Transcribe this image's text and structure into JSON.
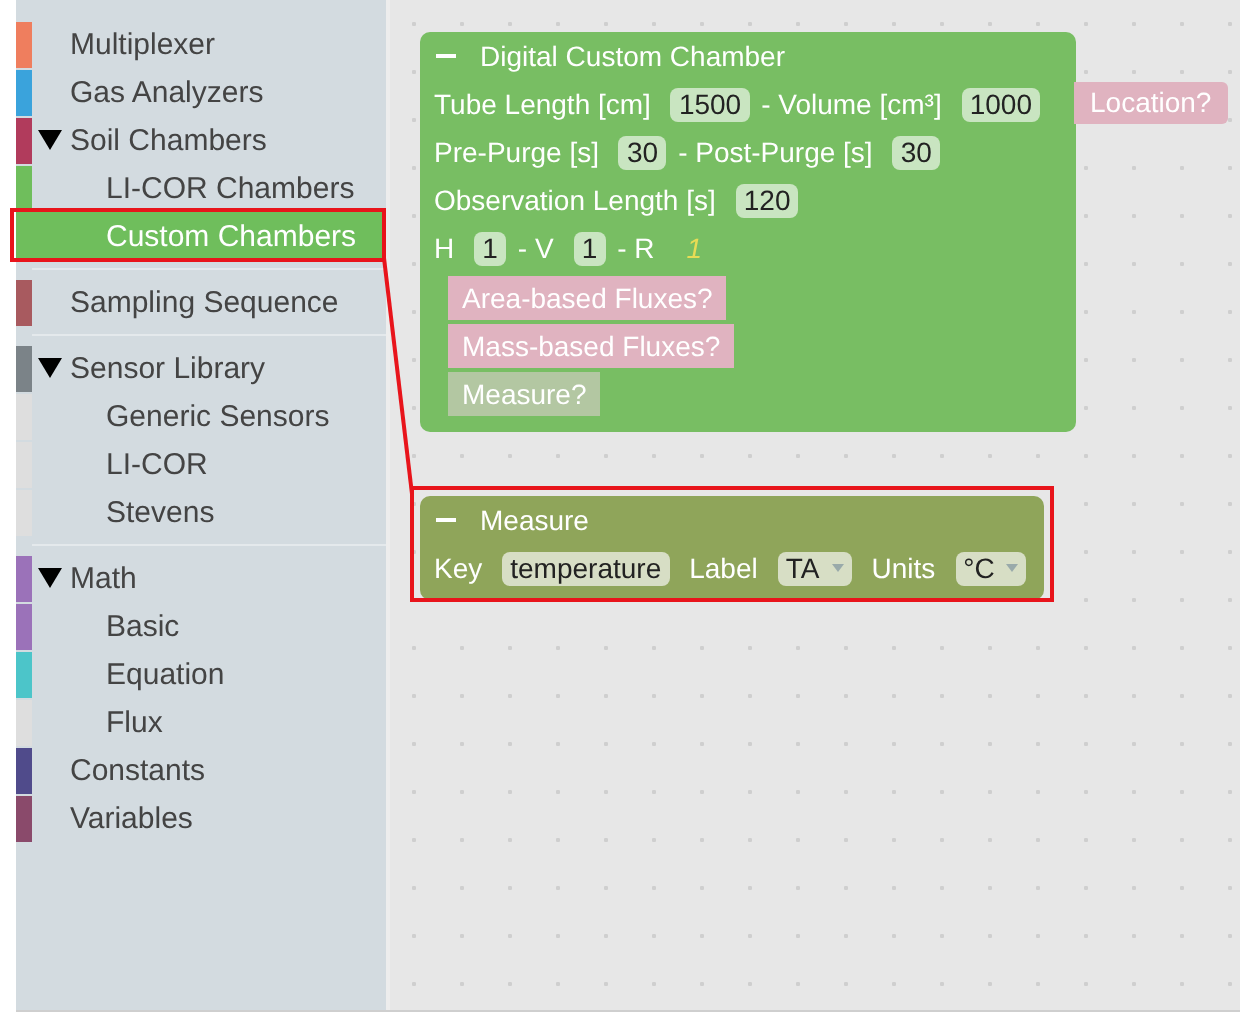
{
  "sidebar": {
    "sections": [
      [
        {
          "label": "Multiplexer",
          "color": "#ef7e5e",
          "selected": false
        },
        {
          "label": "Gas Analyzers",
          "color": "#3aa3dc",
          "selected": false
        },
        {
          "label": "Soil Chambers",
          "color": "#b13b5c",
          "selected": false,
          "expanded": true,
          "children": [
            {
              "label": "LI-COR Chambers",
              "color": "#6fbe5c",
              "selected": false
            },
            {
              "label": "Custom Chambers",
              "color": "#6fbe5c",
              "selected": true
            }
          ]
        }
      ],
      [
        {
          "label": "Sampling Sequence",
          "color": "#a85a5f",
          "selected": false
        }
      ],
      [
        {
          "label": "Sensor Library",
          "color": "#7b8388",
          "selected": false,
          "expanded": true,
          "children": [
            {
              "label": "Generic Sensors",
              "color": "#dedede",
              "selected": false
            },
            {
              "label": "LI-COR",
              "color": "#dedede",
              "selected": false
            },
            {
              "label": "Stevens",
              "color": "#dedede",
              "selected": false
            }
          ]
        }
      ],
      [
        {
          "label": "Math",
          "color": "#9b72b9",
          "selected": false,
          "expanded": true,
          "children": [
            {
              "label": "Basic",
              "color": "#9b72b9",
              "selected": false
            },
            {
              "label": "Equation",
              "color": "#4cc5c9",
              "selected": false
            },
            {
              "label": "Flux",
              "color": "#dedede",
              "selected": false
            }
          ]
        },
        {
          "label": "Constants",
          "color": "#504b8b",
          "selected": false
        },
        {
          "label": "Variables",
          "color": "#8a4a6b",
          "selected": false
        }
      ]
    ]
  },
  "chamber_block": {
    "title": "Digital Custom Chamber",
    "inputs": [
      {
        "fields": [
          {
            "kind": "label",
            "text": "Tube Length [cm]"
          },
          {
            "kind": "number",
            "text": "1500"
          },
          {
            "kind": "label",
            "text": "- Volume [cm³]"
          },
          {
            "kind": "number",
            "text": "1000"
          }
        ]
      },
      {
        "fields": [
          {
            "kind": "label",
            "text": "Pre-Purge [s]"
          },
          {
            "kind": "number",
            "text": "30"
          },
          {
            "kind": "label",
            "text": "- Post-Purge [s]"
          },
          {
            "kind": "number",
            "text": "30"
          }
        ]
      },
      {
        "fields": [
          {
            "kind": "label",
            "text": "Observation Length [s]"
          },
          {
            "kind": "number",
            "text": "120"
          }
        ]
      },
      {
        "fields": [
          {
            "kind": "label",
            "text": "H"
          },
          {
            "kind": "number",
            "text": "1"
          },
          {
            "kind": "label",
            "text": "- V"
          },
          {
            "kind": "number",
            "text": "1"
          },
          {
            "kind": "label",
            "text": "- R"
          },
          {
            "kind": "readonly",
            "text": "1"
          }
        ]
      }
    ],
    "attached": {
      "text": "Location?",
      "color": "#e0b3c0"
    },
    "statements": [
      {
        "text": "Area-based Fluxes?",
        "color": "#e0b3c0"
      },
      {
        "text": "Mass-based Fluxes?",
        "color": "#e0b3c0"
      },
      {
        "text": "Measure?",
        "color": "#b3c7a2"
      }
    ]
  },
  "measure_block": {
    "title": "Measure",
    "fields": [
      {
        "kind": "label",
        "text": "Key"
      },
      {
        "kind": "input",
        "text": "temperature"
      },
      {
        "kind": "label",
        "text": "Label"
      },
      {
        "kind": "dropdown",
        "text": "TA"
      },
      {
        "kind": "label",
        "text": "Units"
      },
      {
        "kind": "dropdown",
        "text": "°C"
      }
    ]
  }
}
